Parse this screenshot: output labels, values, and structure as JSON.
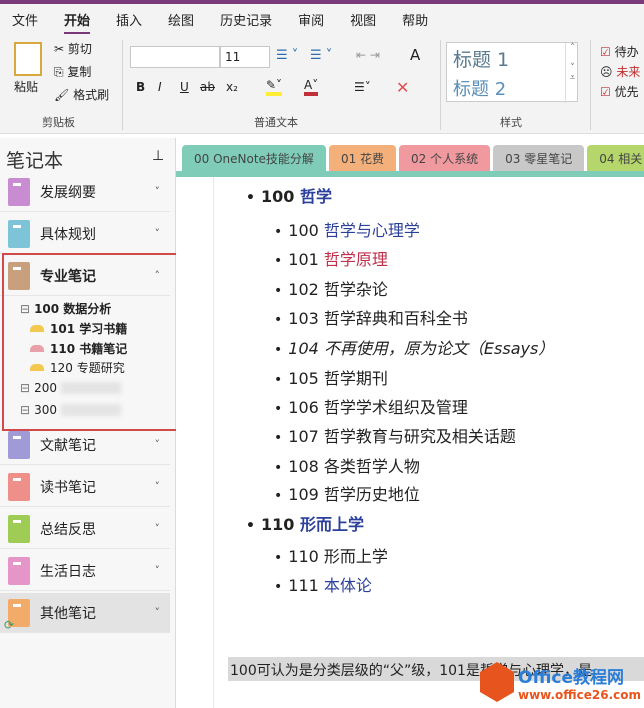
{
  "menu": {
    "items": [
      "文件",
      "开始",
      "插入",
      "绘图",
      "历史记录",
      "审阅",
      "视图",
      "帮助"
    ],
    "active": "开始"
  },
  "ribbon": {
    "clipboard": {
      "paste": "粘贴",
      "cut": "剪切",
      "copy": "复制",
      "format_painter": "格式刷",
      "label": "剪贴板"
    },
    "text": {
      "font": "",
      "size": "11",
      "bold": "B",
      "italic": "I",
      "underline": "U",
      "strike": "ab",
      "sub": "x₂",
      "label": "普通文本"
    },
    "styles": {
      "h1": "标题 1",
      "h2": "标题 2",
      "label": "样式"
    },
    "tags": [
      "待办",
      "未来",
      "优先"
    ]
  },
  "sidebar": {
    "title": "笔记本",
    "notebooks": [
      {
        "name": "发展纲要",
        "color": "#c98bd1"
      },
      {
        "name": "具体规划",
        "color": "#7ec4d8"
      },
      {
        "name": "专业笔记",
        "color": "#c9a07e",
        "expanded": true
      },
      {
        "name": "文献笔记",
        "color": "#a09ad6"
      },
      {
        "name": "读书笔记",
        "color": "#ee8f8a"
      },
      {
        "name": "总结反思",
        "color": "#9fcc55"
      },
      {
        "name": "生活日志",
        "color": "#e595c8"
      },
      {
        "name": "其他笔记",
        "color": "#f3ab6a"
      }
    ],
    "sections": [
      {
        "name": "100 数据分析",
        "type": "group"
      },
      {
        "name": "101 学习书籍",
        "color": "#f2c94c"
      },
      {
        "name": "110 书籍笔记",
        "color": "#e9a0a8"
      },
      {
        "name": "120 专题研究",
        "color": "#f2c94c"
      },
      {
        "name": "200",
        "type": "group"
      },
      {
        "name": "300",
        "type": "group"
      }
    ]
  },
  "tabs": [
    {
      "label": "00 OneNote技能分解",
      "color": "#7fcdb8"
    },
    {
      "label": "01 花费",
      "color": "#f3b07a"
    },
    {
      "label": "02 个人系统",
      "color": "#f09aa0"
    },
    {
      "label": "03 零星笔记",
      "color": "#c8c8c8"
    },
    {
      "label": "04 相关",
      "color": "#b5d66a"
    }
  ],
  "page": {
    "lines": [
      {
        "num": "100",
        "text": "哲学",
        "level": 1,
        "style": "blue"
      },
      {
        "num": "100",
        "text": "哲学与心理学",
        "level": 2,
        "style": "blue"
      },
      {
        "num": "101",
        "text": "哲学原理",
        "level": 2,
        "style": "red"
      },
      {
        "num": "102",
        "text": "哲学杂论",
        "level": 2
      },
      {
        "num": "103",
        "text": "哲学辞典和百科全书",
        "level": 2
      },
      {
        "num": "104",
        "text": "不再使用，原为论文（Essays）",
        "level": 2,
        "style": "italic"
      },
      {
        "num": "105",
        "text": "哲学期刊",
        "level": 2
      },
      {
        "num": "106",
        "text": "哲学学术组织及管理",
        "level": 2
      },
      {
        "num": "107",
        "text": "哲学教育与研究及相关话题",
        "level": 2
      },
      {
        "num": "108",
        "text": "各类哲学人物",
        "level": 2
      },
      {
        "num": "109",
        "text": "哲学历史地位",
        "level": 2
      },
      {
        "num": "110",
        "text": "形而上学",
        "level": 1,
        "style": "blue"
      },
      {
        "num": "110",
        "text": "形而上学",
        "level": 2
      },
      {
        "num": "111",
        "text": "本体论",
        "level": 2,
        "style": "blue"
      }
    ]
  },
  "caption": "100可认为是分类层级的“父”级，101是哲学与心理学，是",
  "watermark": {
    "title": "Office教程网",
    "url": "www.office26.com"
  }
}
